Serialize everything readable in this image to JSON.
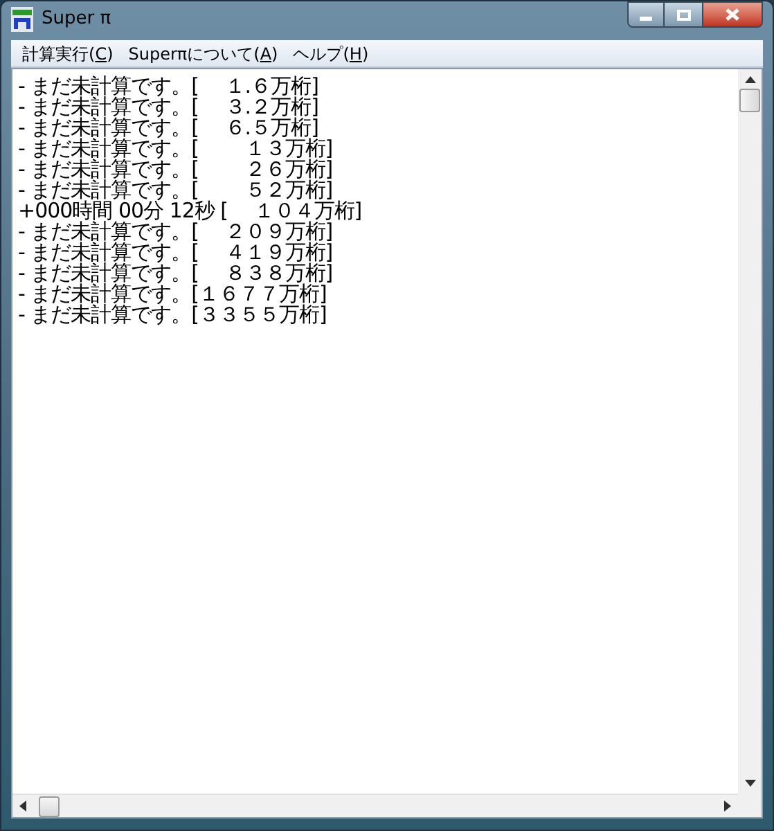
{
  "window": {
    "title": "Super π"
  },
  "menu": [
    {
      "label": "計算実行(C)"
    },
    {
      "label": "Superπについて(A)"
    },
    {
      "label": "ヘルプ(H)"
    }
  ],
  "lines": [
    "- まだ未計算です。[ 　１.６万桁]",
    "- まだ未計算です。[ 　３.２万桁]",
    "- まだ未計算です。[ 　６.５万桁]",
    "- まだ未計算です。[ 　　１３万桁]",
    "- まだ未計算です。[ 　　２６万桁]",
    "- まだ未計算です。[ 　　５２万桁]",
    "+000時間 00分 12秒 [ 　１０４万桁]",
    "- まだ未計算です。[ 　２０９万桁]",
    "- まだ未計算です。[ 　４１９万桁]",
    "- まだ未計算です。[ 　８３８万桁]",
    "- まだ未計算です。[１６７７万桁]",
    "- まだ未計算です。[３３５５万桁]"
  ]
}
